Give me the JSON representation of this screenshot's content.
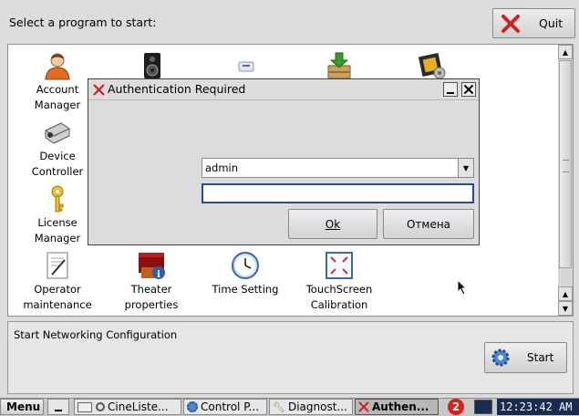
{
  "header": {
    "prompt": "Select a program to start:",
    "quit_label": "Quit"
  },
  "programs": [
    {
      "label": "Account\nManager",
      "icon": "user-icon"
    },
    {
      "label": "",
      "icon": "speaker-icon"
    },
    {
      "label": "",
      "icon": "drive-icon"
    },
    {
      "label": "",
      "icon": "install-icon"
    },
    {
      "label": "",
      "icon": "media-settings-icon"
    },
    {
      "label": "Device\nController",
      "icon": "projector-icon"
    },
    {
      "label": "License\nManager",
      "icon": "key-icon"
    },
    {
      "label": "Operator\nmaintenance",
      "icon": "notepad-icon"
    },
    {
      "label": "Theater\nproperties",
      "icon": "theater-info-icon"
    },
    {
      "label": "Time Setting",
      "icon": "clock-icon"
    },
    {
      "label": "TouchScreen\nCalibration",
      "icon": "calibration-icon"
    }
  ],
  "dialog": {
    "title": "Authentication Required",
    "username_value": "admin",
    "password_value": "",
    "ok_label": "Ok",
    "cancel_label": "Отмена"
  },
  "footer": {
    "description": "Start Networking Configuration",
    "start_label": "Start"
  },
  "taskbar": {
    "menu_label": "Menu",
    "tasks": [
      "CineListe...",
      "Control P...",
      "Diagnost...",
      "Authen..."
    ],
    "notification_count": "2",
    "clock": "12:23:42 AM"
  },
  "colors": {
    "accent_blue": "#3a5fa0",
    "close_red": "#cc2222",
    "badge_red": "#d42020",
    "clock_bg": "#1a2a50"
  }
}
